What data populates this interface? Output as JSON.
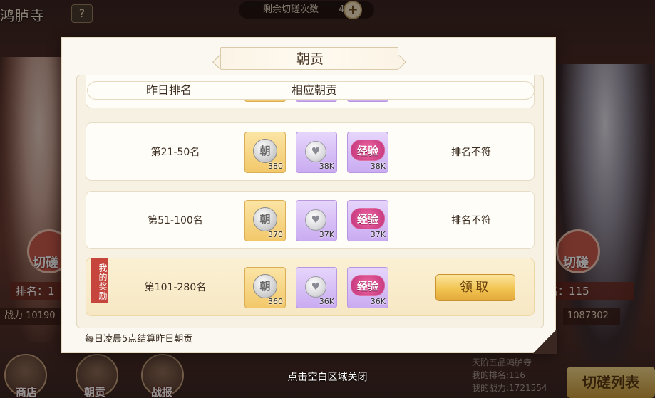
{
  "background": {
    "location_title": "鸿胪寺",
    "help_label": "?",
    "remaining_label": "剩余切磋次数",
    "remaining_count": "4",
    "plus_label": "+",
    "left_badge": "切磋",
    "right_badge": "切磋",
    "left_rank": "排名：1",
    "right_rank": "名：115",
    "left_power": "战力 10190",
    "right_power": "1087302",
    "nav": [
      {
        "label": "商店",
        "icon": "shop-icon"
      },
      {
        "label": "朝贡",
        "icon": "tribute-icon"
      },
      {
        "label": "战报",
        "icon": "battle-report-icon"
      }
    ],
    "info_lines": [
      "天阶五品鸿胪寺",
      "我的排名:116",
      "我的战力:1721554"
    ],
    "list_button": "切磋列表"
  },
  "modal": {
    "title": "朝贡",
    "columns": {
      "rank": "昨日排名",
      "reward": "相应朝贡"
    },
    "rows": [
      {
        "rank": "第21-50名",
        "items": [
          {
            "type": "tribute-coin",
            "symbol": "朝",
            "qty": "380"
          },
          {
            "type": "silver-gem",
            "symbol": "♥",
            "qty": "38K"
          },
          {
            "type": "exp-token",
            "symbol": "经验",
            "qty": "38K"
          }
        ],
        "status": "排名不符"
      },
      {
        "rank": "第51-100名",
        "items": [
          {
            "type": "tribute-coin",
            "symbol": "朝",
            "qty": "370"
          },
          {
            "type": "silver-gem",
            "symbol": "♥",
            "qty": "37K"
          },
          {
            "type": "exp-token",
            "symbol": "经验",
            "qty": "37K"
          }
        ],
        "status": "排名不符"
      },
      {
        "rank": "第101-280名",
        "mine_label": "我的奖励",
        "items": [
          {
            "type": "tribute-coin",
            "symbol": "朝",
            "qty": "360"
          },
          {
            "type": "silver-gem",
            "symbol": "♥",
            "qty": "36K"
          },
          {
            "type": "exp-token",
            "symbol": "经验",
            "qty": "36K"
          }
        ],
        "action": "领取"
      }
    ],
    "footer": "每日凌晨5点结算昨日朝贡"
  },
  "close_hint": "点击空白区域关闭",
  "colors": {
    "modal_bg": "#fbf8f1",
    "highlight_row": "#f7e8c4",
    "gold_item": "#f2c86a",
    "purple_item": "#c9abf1",
    "claim_button": "#f1c452",
    "ribbon": "#c6463e"
  }
}
